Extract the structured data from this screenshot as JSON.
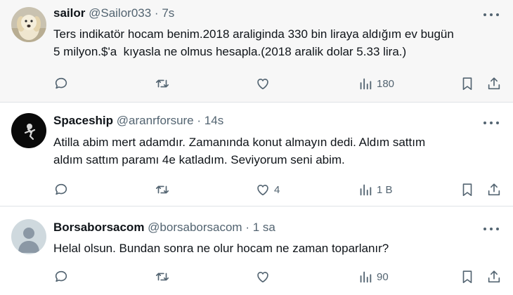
{
  "tweets": [
    {
      "name": "sailor",
      "handle": "@Sailor033",
      "separator": "·",
      "time": "7s",
      "text": "Ters indikatör hocam benim.2018 araliginda 330 bin liraya aldığım ev bugün\n5 milyon.$'a  kıyasla ne olmus hesapla.(2018 aralik dolar 5.33 lira.)",
      "likes": "",
      "views": "180"
    },
    {
      "name": "Spaceship",
      "handle": "@aranrforsure",
      "separator": "·",
      "time": "14s",
      "text": "Atilla abim mert adamdır. Zamanında konut almayın dedi. Aldım sattım\naldım sattım paramı 4e katladım. Seviyorum seni abim.",
      "likes": "4",
      "views": "1 B"
    },
    {
      "name": "Borsaborsacom",
      "handle": "@borsaborsacom",
      "separator": "·",
      "time": "1 sa",
      "text": "Helal olsun. Bundan sonra ne olur hocam ne zaman toparlanır?",
      "likes": "",
      "views": "90"
    }
  ],
  "icons": {
    "reply": "reply-icon",
    "retweet": "retweet-icon",
    "like": "heart-icon",
    "views": "views-icon",
    "bookmark": "bookmark-icon",
    "share": "share-icon",
    "more": "more-icon"
  },
  "colors": {
    "text": "#0f1419",
    "secondary": "#536471",
    "divider": "#dfe3e6",
    "highlight_bg": "#f7f7f7"
  }
}
